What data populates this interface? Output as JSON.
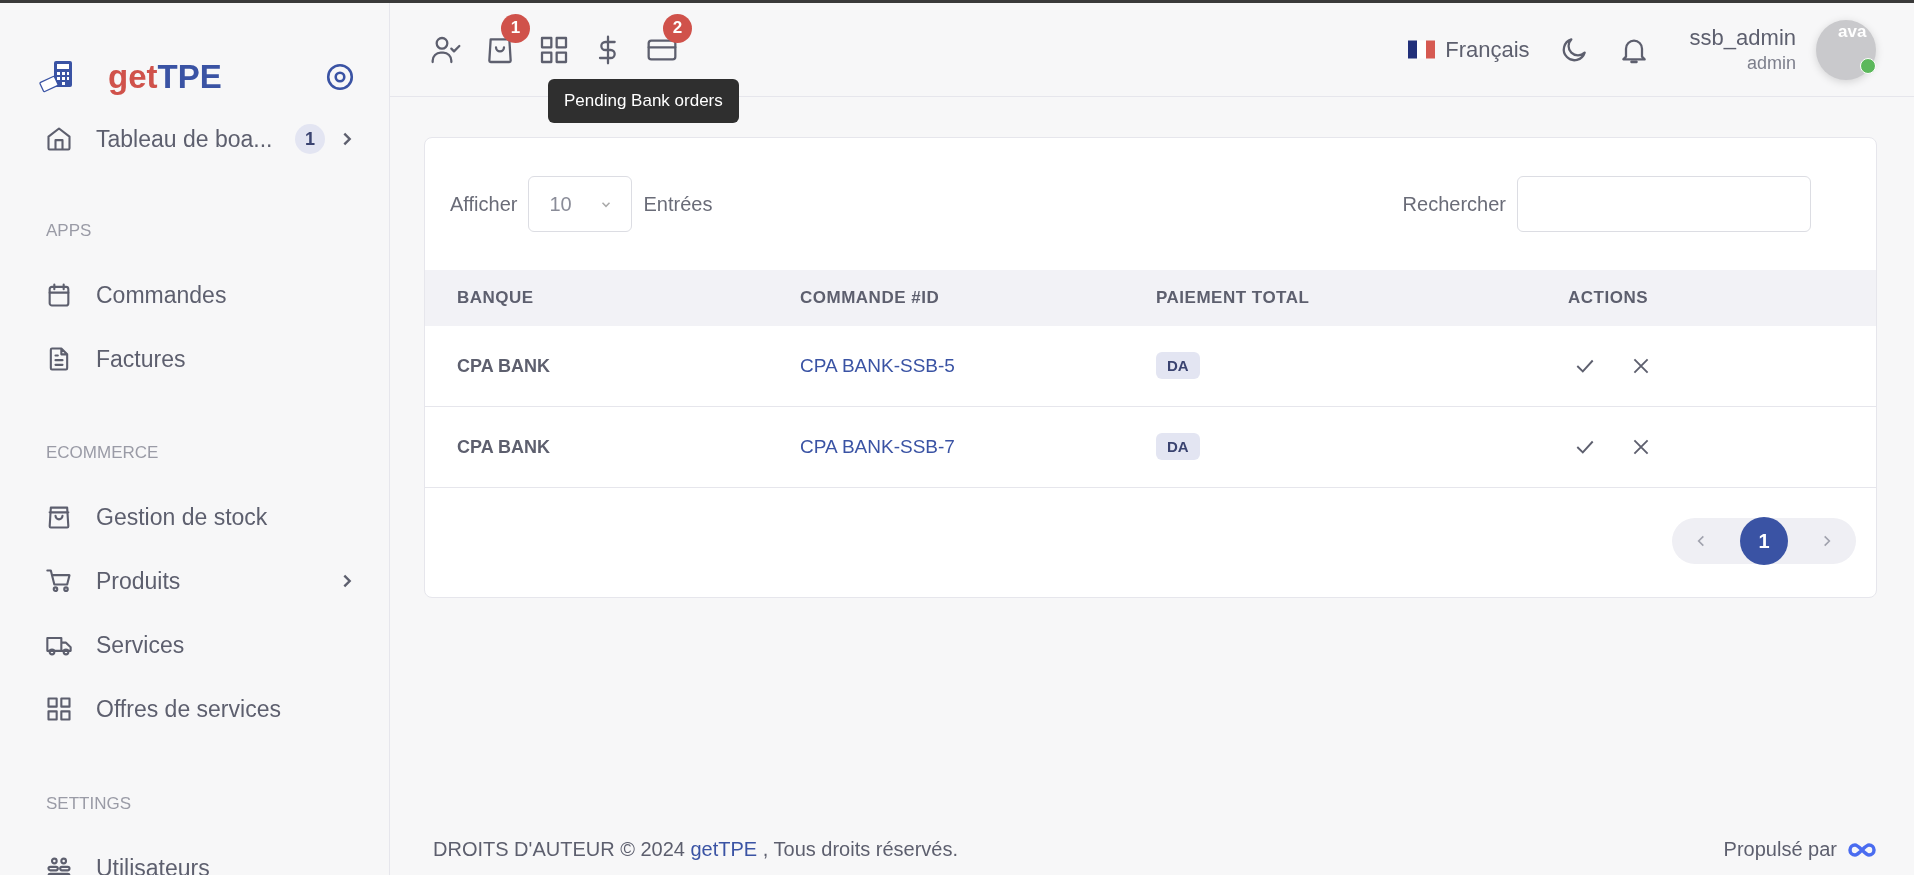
{
  "sidebar": {
    "logo": {
      "first": "get",
      "second": "TPE"
    },
    "top_item": {
      "label": "Tableau de boa...",
      "kind": "home",
      "badge": "1",
      "has_submenu": true
    },
    "sections": [
      {
        "title": "APPS",
        "items": [
          {
            "label": "Commandes",
            "kind": "calendar",
            "has_submenu": false
          },
          {
            "label": "Factures",
            "kind": "file",
            "has_submenu": false
          }
        ]
      },
      {
        "title": "ECOMMERCE",
        "items": [
          {
            "label": "Gestion de stock",
            "kind": "bag",
            "has_submenu": false
          },
          {
            "label": "Produits",
            "kind": "cart",
            "has_submenu": true
          },
          {
            "label": "Services",
            "kind": "truck",
            "has_submenu": false
          },
          {
            "label": "Offres de services",
            "kind": "grid",
            "has_submenu": false
          }
        ]
      },
      {
        "title": "SETTINGS",
        "items": [
          {
            "label": "Utilisateurs",
            "kind": "users",
            "has_submenu": false
          }
        ]
      }
    ]
  },
  "header": {
    "icons": [
      {
        "kind": "user-check"
      },
      {
        "kind": "bag",
        "badge": "1"
      },
      {
        "kind": "grid"
      },
      {
        "kind": "dollar"
      },
      {
        "kind": "card",
        "badge": "2"
      }
    ],
    "tooltip": "Pending Bank orders",
    "language": "Français",
    "user": {
      "name": "ssb_admin",
      "role": "admin",
      "avatar_alt": "ava",
      "online": true
    }
  },
  "table_card": {
    "show_label": "Afficher",
    "page_size": "10",
    "entries_label": "Entrées",
    "search_label": "Rechercher",
    "columns": [
      "BANQUE",
      "COMMANDE #ID",
      "PAIEMENT TOTAL",
      "ACTIONS"
    ],
    "rows": [
      {
        "bank": "CPA BANK",
        "order": "CPA BANK-SSB-5",
        "payment": "DA"
      },
      {
        "bank": "CPA BANK",
        "order": "CPA BANK-SSB-7",
        "payment": "DA"
      }
    ],
    "pages": [
      {
        "label": "1",
        "selected": true
      }
    ]
  },
  "footer": {
    "prefix": "DROITS D'AUTEUR © 2024 ",
    "link": "getTPE",
    "suffix": " , Tous droits réservés.",
    "powered_by": "Propulsé par"
  }
}
